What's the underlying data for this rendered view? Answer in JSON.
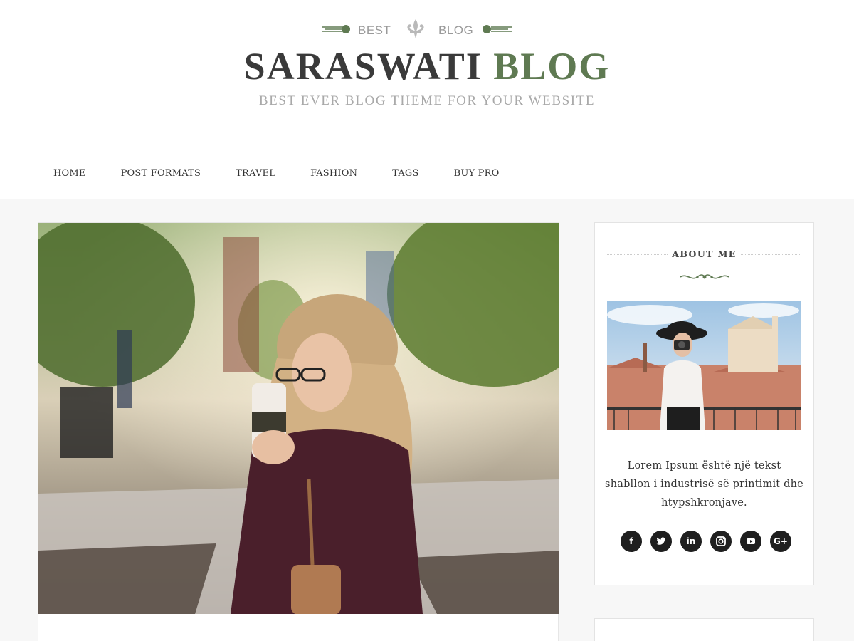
{
  "header": {
    "top_left_word": "BEST",
    "top_right_word": "BLOG",
    "title_main": "SARASWATI",
    "title_accent": "BLOG",
    "tagline": "BEST EVER BLOG THEME FOR YOUR WEBSITE",
    "colors": {
      "title": "#3a3a3a",
      "accent": "#5f7a52",
      "muted": "#a9a9a9"
    }
  },
  "nav": {
    "items": [
      {
        "label": "HOME"
      },
      {
        "label": "POST FORMATS"
      },
      {
        "label": "TRAVEL"
      },
      {
        "label": "FASHION"
      },
      {
        "label": "TAGS"
      },
      {
        "label": "BUY PRO"
      }
    ]
  },
  "post": {
    "image_icon": "photo-woman-drinking-coffee"
  },
  "sidebar": {
    "about": {
      "title": "ABOUT ME",
      "photo_icon": "photo-woman-with-camera",
      "text": "Lorem Ipsum është një tekst shabllon i industrisë së printimit dhe htypshkronjave.",
      "social": [
        {
          "icon": "facebook-icon",
          "glyph": "f"
        },
        {
          "icon": "twitter-icon",
          "glyph": "t"
        },
        {
          "icon": "linkedin-icon",
          "glyph": "in"
        },
        {
          "icon": "instagram-icon",
          "glyph": "◎"
        },
        {
          "icon": "youtube-icon",
          "glyph": "▶"
        },
        {
          "icon": "google-plus-icon",
          "glyph": "G+"
        }
      ]
    }
  }
}
